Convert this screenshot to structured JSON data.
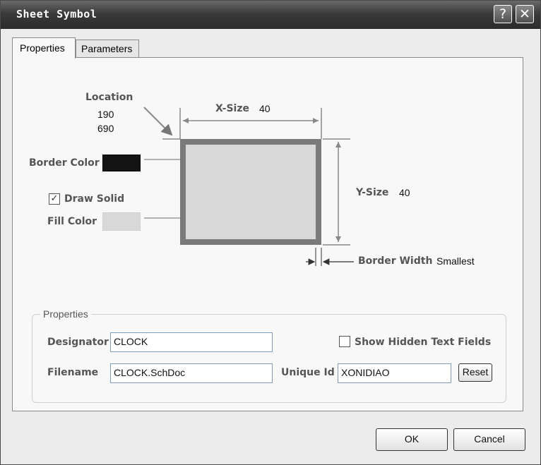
{
  "window": {
    "title": "Sheet Symbol",
    "help_icon_glyph": "?",
    "close_icon_glyph": "✕"
  },
  "tabs": [
    {
      "label": "Properties",
      "active": true
    },
    {
      "label": "Parameters",
      "active": false
    }
  ],
  "graphic": {
    "location_label": "Location",
    "location_x": "190",
    "location_y": "690",
    "xsize_label": "X-Size",
    "xsize_value": "40",
    "ysize_label": "Y-Size",
    "ysize_value": "40",
    "border_color_label": "Border Color",
    "border_color": "#141414",
    "draw_solid_label": "Draw Solid",
    "draw_solid_checked": true,
    "fill_color_label": "Fill Color",
    "fill_color": "#d8d8d8",
    "border_width_label": "Border Width",
    "border_width_value": "Smallest"
  },
  "properties": {
    "legend": "Properties",
    "designator_label": "Designator",
    "designator_value": "CLOCK",
    "filename_label": "Filename",
    "filename_value": "CLOCK.SchDoc",
    "show_hidden_label": "Show Hidden Text Fields",
    "show_hidden_checked": false,
    "unique_id_label": "Unique Id",
    "unique_id_value": "XONIDIAO",
    "reset_label": "Reset"
  },
  "buttons": {
    "ok_label": "OK",
    "cancel_label": "Cancel"
  }
}
